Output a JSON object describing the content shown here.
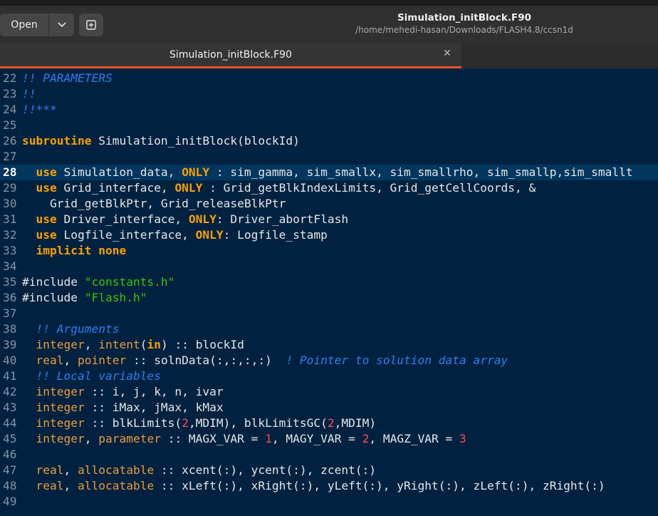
{
  "header": {
    "open_label": "Open",
    "dropdown_icon": "chevron-down-icon",
    "new_tab_icon": "new-tab-icon",
    "title": "Simulation_initBlock.F90",
    "path": "/home/mehedi-hasan/Downloads/FLASH4.8/ccsn1d"
  },
  "tabs": [
    {
      "label": "Simulation_initBlock.F90",
      "active": true,
      "close_icon": "close-icon"
    }
  ],
  "colors": {
    "editor_bg": "#002240",
    "current_line_bg": "#01365f",
    "comment": "#2f7ef0",
    "keyword": "#f8a000",
    "string": "#3fc400",
    "number": "#ff4b4b",
    "accent": "#e95420"
  },
  "editor": {
    "current_line": 28,
    "lines": [
      {
        "n": "22",
        "tokens": [
          [
            "comment",
            "!! PARAMETERS"
          ]
        ]
      },
      {
        "n": "23",
        "tokens": [
          [
            "comment",
            "!!"
          ]
        ]
      },
      {
        "n": "24",
        "tokens": [
          [
            "comment",
            "!!***"
          ]
        ]
      },
      {
        "n": "25",
        "tokens": []
      },
      {
        "n": "26",
        "tokens": [
          [
            "keyword",
            "subroutine"
          ],
          [
            "plain",
            " Simulation_initBlock(blockId)"
          ]
        ]
      },
      {
        "n": "27",
        "tokens": []
      },
      {
        "n": "28",
        "tokens": [
          [
            "plain",
            "  "
          ],
          [
            "keyword",
            "use"
          ],
          [
            "plain",
            " Simulation_data, "
          ],
          [
            "keyword",
            "ONLY"
          ],
          [
            "plain",
            " : sim_gamma, sim_smallx, sim_smallrho, sim_smallp,sim_smallt"
          ]
        ]
      },
      {
        "n": "29",
        "tokens": [
          [
            "plain",
            "  "
          ],
          [
            "keyword",
            "use"
          ],
          [
            "plain",
            " Grid_interface, "
          ],
          [
            "keyword",
            "ONLY"
          ],
          [
            "plain",
            " : Grid_getBlkIndexLimits, Grid_getCellCoords, &"
          ]
        ]
      },
      {
        "n": "30",
        "tokens": [
          [
            "plain",
            "    Grid_getBlkPtr, Grid_releaseBlkPtr"
          ]
        ]
      },
      {
        "n": "31",
        "tokens": [
          [
            "plain",
            "  "
          ],
          [
            "keyword",
            "use"
          ],
          [
            "plain",
            " Driver_interface, "
          ],
          [
            "keyword",
            "ONLY"
          ],
          [
            "plain",
            ": Driver_abortFlash"
          ]
        ]
      },
      {
        "n": "32",
        "tokens": [
          [
            "plain",
            "  "
          ],
          [
            "keyword",
            "use"
          ],
          [
            "plain",
            " Logfile_interface, "
          ],
          [
            "keyword",
            "ONLY"
          ],
          [
            "plain",
            ": Logfile_stamp"
          ]
        ]
      },
      {
        "n": "33",
        "tokens": [
          [
            "plain",
            "  "
          ],
          [
            "keyword",
            "implicit none"
          ]
        ]
      },
      {
        "n": "34",
        "tokens": []
      },
      {
        "n": "35",
        "tokens": [
          [
            "pre",
            "#include "
          ],
          [
            "string",
            "\"constants.h\""
          ]
        ]
      },
      {
        "n": "36",
        "tokens": [
          [
            "pre",
            "#include "
          ],
          [
            "string",
            "\"Flash.h\""
          ]
        ]
      },
      {
        "n": "37",
        "tokens": []
      },
      {
        "n": "38",
        "tokens": [
          [
            "plain",
            "  "
          ],
          [
            "comment",
            "!! Arguments"
          ]
        ]
      },
      {
        "n": "39",
        "tokens": [
          [
            "plain",
            "  "
          ],
          [
            "type",
            "integer"
          ],
          [
            "plain",
            ", "
          ],
          [
            "type",
            "intent"
          ],
          [
            "plain",
            "("
          ],
          [
            "keyword",
            "in"
          ],
          [
            "plain",
            ") :: blockId"
          ]
        ]
      },
      {
        "n": "40",
        "tokens": [
          [
            "plain",
            "  "
          ],
          [
            "type",
            "real"
          ],
          [
            "plain",
            ", "
          ],
          [
            "type",
            "pointer"
          ],
          [
            "plain",
            " :: solnData(:,:,:,:)  "
          ],
          [
            "comment",
            "! Pointer to solution data array"
          ]
        ]
      },
      {
        "n": "41",
        "tokens": [
          [
            "plain",
            "  "
          ],
          [
            "comment",
            "!! Local variables"
          ]
        ]
      },
      {
        "n": "42",
        "tokens": [
          [
            "plain",
            "  "
          ],
          [
            "type",
            "integer"
          ],
          [
            "plain",
            " :: i, j, k, n, ivar"
          ]
        ]
      },
      {
        "n": "43",
        "tokens": [
          [
            "plain",
            "  "
          ],
          [
            "type",
            "integer"
          ],
          [
            "plain",
            " :: iMax, jMax, kMax"
          ]
        ]
      },
      {
        "n": "44",
        "tokens": [
          [
            "plain",
            "  "
          ],
          [
            "type",
            "integer"
          ],
          [
            "plain",
            " :: blkLimits("
          ],
          [
            "number",
            "2"
          ],
          [
            "plain",
            ",MDIM), blkLimitsGC("
          ],
          [
            "number",
            "2"
          ],
          [
            "plain",
            ",MDIM)"
          ]
        ]
      },
      {
        "n": "45",
        "tokens": [
          [
            "plain",
            "  "
          ],
          [
            "type",
            "integer"
          ],
          [
            "plain",
            ", "
          ],
          [
            "type",
            "parameter"
          ],
          [
            "plain",
            " :: MAGX_VAR = "
          ],
          [
            "number",
            "1"
          ],
          [
            "plain",
            ", MAGY_VAR = "
          ],
          [
            "number",
            "2"
          ],
          [
            "plain",
            ", MAGZ_VAR = "
          ],
          [
            "number",
            "3"
          ]
        ]
      },
      {
        "n": "46",
        "tokens": []
      },
      {
        "n": "47",
        "tokens": [
          [
            "plain",
            "  "
          ],
          [
            "type",
            "real"
          ],
          [
            "plain",
            ", "
          ],
          [
            "type",
            "allocatable"
          ],
          [
            "plain",
            " :: xcent(:), ycent(:), zcent(:)"
          ]
        ]
      },
      {
        "n": "48",
        "tokens": [
          [
            "plain",
            "  "
          ],
          [
            "type",
            "real"
          ],
          [
            "plain",
            ", "
          ],
          [
            "type",
            "allocatable"
          ],
          [
            "plain",
            " :: xLeft(:), xRight(:), yLeft(:), yRight(:), zLeft(:), zRight(:)"
          ]
        ]
      },
      {
        "n": "49",
        "tokens": []
      }
    ]
  }
}
